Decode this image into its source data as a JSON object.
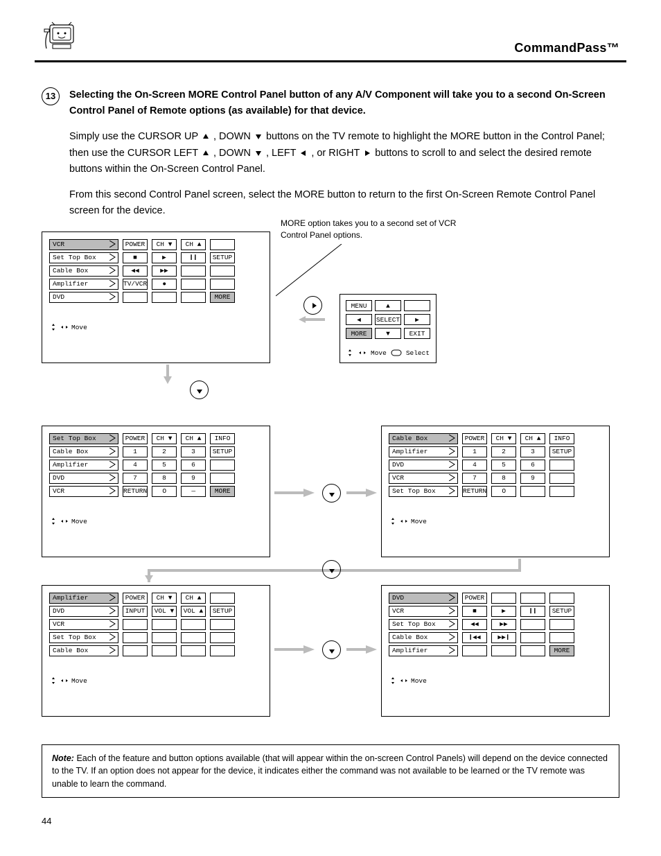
{
  "header": {
    "title": "CommandPass™"
  },
  "step": {
    "number": "13",
    "lead": "Selecting the On-Screen MORE Control Panel button of any A/V Component will take you to a second On-Screen Control Panel of Remote options (as available) for that device.",
    "body_before_arrows": "Simply use the CURSOR UP",
    "body_mid1": ", DOWN",
    "body_mid2": " buttons on the TV remote to highlight the MORE button in the Control Panel; then use the CURSOR LEFT",
    "body_mid3": ", DOWN",
    "body_mid4": ", LEFT",
    "body_mid5": ", or RIGHT",
    "body_mid6": " buttons to scroll to and select the desired remote buttons within the On-Screen Control Panel.",
    "body_trail": "From this second Control Panel screen, select the MORE button to return to the first On-Screen Remote Control Panel screen for the device."
  },
  "sub_panel": {
    "caption": "MORE option takes you to a second set of VCR Control Panel options.",
    "rows": [
      [
        "MENU",
        "▲",
        ""
      ],
      [
        "◀",
        "SELECT",
        "▶"
      ],
      [
        "MORE",
        "▼",
        "EXIT"
      ]
    ],
    "hint_move": "Move",
    "hint_select": "Select"
  },
  "panels": {
    "p1": {
      "devices": [
        {
          "n": "VCR",
          "sel": true
        },
        {
          "n": "Set Top Box"
        },
        {
          "n": "Cable Box"
        },
        {
          "n": "Amplifier"
        },
        {
          "n": "DVD"
        }
      ],
      "grid": [
        [
          "POWER",
          "CH ▼",
          "CH ▲",
          ""
        ],
        [
          "■",
          "▶",
          "❙❙",
          "SETUP"
        ],
        [
          "◀◀",
          "▶▶",
          "",
          ""
        ],
        [
          "TV/VCR",
          "●",
          "",
          ""
        ],
        [
          "",
          "",
          "",
          "MORE"
        ]
      ]
    },
    "p2": {
      "devices": [
        {
          "n": "Set Top Box",
          "sel": true
        },
        {
          "n": "Cable Box"
        },
        {
          "n": "Amplifier"
        },
        {
          "n": "DVD"
        },
        {
          "n": "VCR"
        }
      ],
      "grid": [
        [
          "POWER",
          "CH ▼",
          "CH ▲",
          "INFO"
        ],
        [
          "1",
          "2",
          "3",
          "SETUP"
        ],
        [
          "4",
          "5",
          "6",
          ""
        ],
        [
          "7",
          "8",
          "9",
          ""
        ],
        [
          "RETURN",
          "O",
          "—",
          "MORE"
        ]
      ]
    },
    "p3": {
      "devices": [
        {
          "n": "Cable Box",
          "sel": true
        },
        {
          "n": "Amplifier"
        },
        {
          "n": "DVD"
        },
        {
          "n": "VCR"
        },
        {
          "n": "Set Top Box"
        }
      ],
      "grid": [
        [
          "POWER",
          "CH ▼",
          "CH ▲",
          "INFO"
        ],
        [
          "1",
          "2",
          "3",
          "SETUP"
        ],
        [
          "4",
          "5",
          "6",
          ""
        ],
        [
          "7",
          "8",
          "9",
          ""
        ],
        [
          "RETURN",
          "O",
          "",
          ""
        ]
      ]
    },
    "p4": {
      "devices": [
        {
          "n": "Amplifier",
          "sel": true
        },
        {
          "n": "DVD"
        },
        {
          "n": "VCR"
        },
        {
          "n": "Set Top Box"
        },
        {
          "n": "Cable Box"
        }
      ],
      "grid": [
        [
          "POWER",
          "CH ▼",
          "CH ▲",
          ""
        ],
        [
          "INPUT",
          "VOL ▼",
          "VOL ▲",
          "SETUP"
        ],
        [
          "",
          "",
          "",
          ""
        ],
        [
          "",
          "",
          "",
          ""
        ],
        [
          "",
          "",
          "",
          ""
        ]
      ]
    },
    "p5": {
      "devices": [
        {
          "n": "DVD",
          "sel": true
        },
        {
          "n": "VCR"
        },
        {
          "n": "Set Top Box"
        },
        {
          "n": "Cable Box"
        },
        {
          "n": "Amplifier"
        }
      ],
      "grid": [
        [
          "POWER",
          "",
          "",
          ""
        ],
        [
          "■",
          "▶",
          "❙❙",
          "SETUP"
        ],
        [
          "◀◀",
          "▶▶",
          "",
          ""
        ],
        [
          "❙◀◀",
          "▶▶❙",
          "",
          ""
        ],
        [
          "",
          "",
          "",
          "MORE"
        ]
      ]
    },
    "hint": "Move"
  },
  "note": {
    "lead": "Note:",
    "body": "Each of the feature and button options available (that will appear within the on-screen Control Panels) will depend on the device connected to the TV. If an option does not appear for the device, it indicates either the command was not available to be learned or the TV remote was unable to learn the command."
  },
  "page_number": "44"
}
